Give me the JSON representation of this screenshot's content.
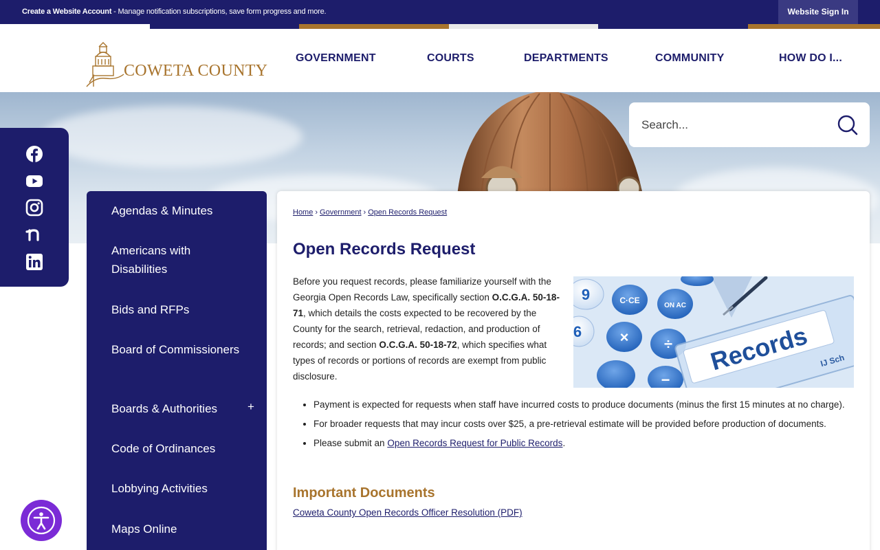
{
  "topbar": {
    "message_bold": "Create a Website Account",
    "message_rest": " - Manage notification subscriptions, save form progress and more.",
    "signin_label": "Website Sign In"
  },
  "colors": {
    "navy": "#1d1d6b",
    "gold": "#a8742d",
    "accessibility_purple": "#7b2bd6"
  },
  "logo": {
    "text": "COWETA COUNTY"
  },
  "nav": [
    {
      "label": "GOVERNMENT"
    },
    {
      "label": "COURTS"
    },
    {
      "label": "DEPARTMENTS"
    },
    {
      "label": "COMMUNITY"
    },
    {
      "label": "HOW DO I..."
    }
  ],
  "search": {
    "placeholder": "Search...",
    "icon": "search-icon"
  },
  "social": [
    {
      "icon": "facebook-icon"
    },
    {
      "icon": "youtube-icon"
    },
    {
      "icon": "instagram-icon"
    },
    {
      "icon": "nextdoor-icon"
    },
    {
      "icon": "linkedin-icon"
    }
  ],
  "sidebar": {
    "items": [
      {
        "label": "Agendas & Minutes"
      },
      {
        "label": "Americans with Disabilities"
      },
      {
        "label": "Bids and RFPs"
      },
      {
        "label": "Board of Commissioners"
      },
      {
        "label": "Boards & Authorities",
        "expand": "+"
      },
      {
        "label": "Code of Ordinances"
      },
      {
        "label": "Lobbying Activities"
      },
      {
        "label": "Maps Online"
      }
    ]
  },
  "breadcrumb": {
    "items": [
      {
        "label": "Home"
      },
      {
        "label": "Government"
      },
      {
        "label": "Open Records Request"
      }
    ],
    "separator": "›"
  },
  "main": {
    "title": "Open Records Request",
    "intro_1": "Before you request records, please familiarize yourself with the Georgia Open Records Law, specifically section ",
    "code_1": "O.C.G.A. 50-18-71",
    "intro_2": ", which details the costs expected to be recovered by the County for the search, retrieval, redaction, and production of records; and section ",
    "code_2": "O.C.G.A. 50-18-72",
    "intro_3": ", which specifies what types of records or portions of records are exempt from public disclosure.",
    "image": {
      "keys": [
        "9",
        "C·CE",
        "ON AC",
        "6",
        "×",
        "÷",
        "−"
      ],
      "card_text": "Records",
      "tab_text": "IJ Sch"
    },
    "bullets": {
      "b1": "Payment is expected for requests when staff have incurred costs to produce documents (minus the first 15 minutes at no charge).",
      "b2": "For broader requests that may incur costs over $25, a pre-retrieval estimate will be provided before production of documents.",
      "b3_pre": "Please submit an ",
      "b3_link": "Open Records Request for Public Records",
      "b3_post": "."
    },
    "docs_title": "Important Documents",
    "doc_link": "Coweta County Open Records Officer Resolution (PDF)"
  },
  "accessibility": {
    "icon": "accessibility-icon"
  }
}
